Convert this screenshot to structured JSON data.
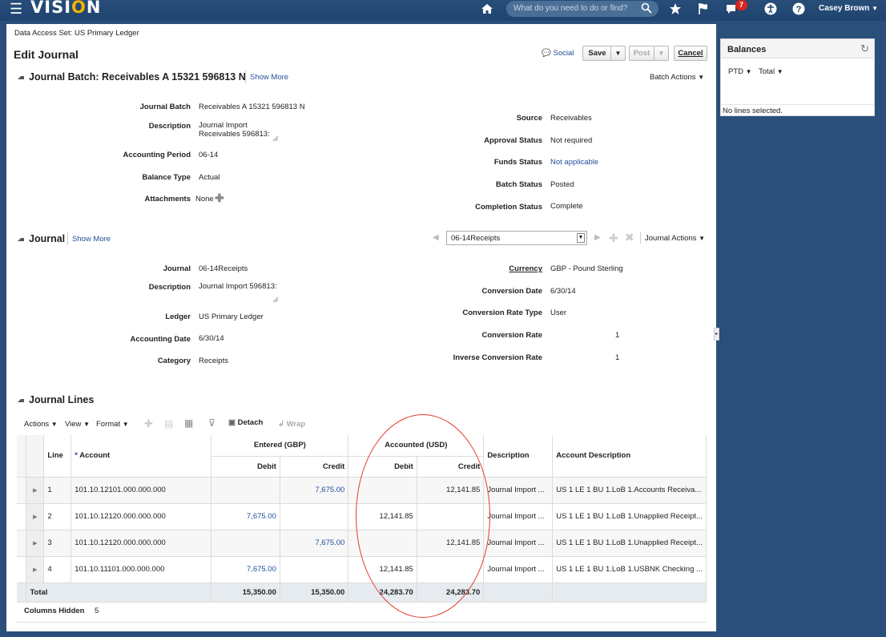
{
  "topbar": {
    "app_name_pre": "VISI",
    "app_name_o": "O",
    "app_name_post": "N",
    "search_placeholder": "What do you need to do or find?",
    "notification_count": "7",
    "user_name": "Casey Brown"
  },
  "page": {
    "data_access_set": "Data Access Set: US Primary Ledger",
    "title": "Edit Journal",
    "social": "Social",
    "save": "Save",
    "post": "Post",
    "cancel": "Cancel"
  },
  "batch": {
    "header": "Journal Batch: Receivables A 15321 596813 N",
    "show_more": "Show More",
    "batch_actions": "Batch Actions",
    "fields_left": [
      {
        "label": "Journal Batch",
        "value": "Receivables A 15321 596813 N"
      },
      {
        "label": "Description",
        "value": "Journal Import",
        "value2": "Receivables 596813:"
      },
      {
        "label": "Accounting Period",
        "value": "06-14"
      },
      {
        "label": "Balance Type",
        "value": "Actual"
      },
      {
        "label": "Attachments",
        "value": "None"
      }
    ],
    "fields_right": [
      {
        "label": "Source",
        "value": "Receivables"
      },
      {
        "label": "Approval Status",
        "value": "Not required"
      },
      {
        "label": "Funds Status",
        "value": "Not applicable"
      },
      {
        "label": "Batch Status",
        "value": "Posted"
      },
      {
        "label": "Completion Status",
        "value": "Complete"
      }
    ]
  },
  "journal": {
    "header": "Journal",
    "show_more": "Show More",
    "selector": "06-14Receipts",
    "journal_actions": "Journal Actions",
    "fields_left": [
      {
        "label": "Journal",
        "value": "06-14Receipts"
      },
      {
        "label": "Description",
        "value": "Journal Import 596813:"
      },
      {
        "label": "Ledger",
        "value": "US Primary Ledger"
      },
      {
        "label": "Accounting Date",
        "value": "6/30/14"
      },
      {
        "label": "Category",
        "value": "Receipts"
      }
    ],
    "fields_right": [
      {
        "label": "Currency",
        "value": "GBP - Pound Sterling"
      },
      {
        "label": "Conversion Date",
        "value": "6/30/14"
      },
      {
        "label": "Conversion Rate Type",
        "value": "User"
      },
      {
        "label": "Conversion Rate",
        "value": "1"
      },
      {
        "label": "Inverse Conversion Rate",
        "value": "1"
      }
    ]
  },
  "lines": {
    "header": "Journal Lines",
    "toolbar": {
      "actions": "Actions",
      "view": "View",
      "format": "Format",
      "detach": "Detach",
      "wrap": "Wrap"
    },
    "columns": {
      "line": "Line",
      "required_mark": "*",
      "account": "Account",
      "entered": "Entered (GBP)",
      "accounted": "Accounted (USD)",
      "debit": "Debit",
      "credit": "Credit",
      "description": "Description",
      "account_description": "Account Description"
    },
    "rows": [
      {
        "line": "1",
        "account": "101.10.12101.000.000.000",
        "ent_debit": "",
        "ent_credit": "7,675.00",
        "acc_debit": "",
        "acc_credit": "12,141.85",
        "description": "Journal Import ...",
        "account_description": "US 1 LE 1 BU 1.LoB 1.Accounts Receiva..."
      },
      {
        "line": "2",
        "account": "101.10.12120.000.000.000",
        "ent_debit": "7,675.00",
        "ent_credit": "",
        "acc_debit": "12,141.85",
        "acc_credit": "",
        "description": "Journal Import ...",
        "account_description": "US 1 LE 1 BU 1.LoB 1.Unapplied Receipt..."
      },
      {
        "line": "3",
        "account": "101.10.12120.000.000.000",
        "ent_debit": "",
        "ent_credit": "7,675.00",
        "acc_debit": "",
        "acc_credit": "12,141.85",
        "description": "Journal Import ...",
        "account_description": "US 1 LE 1 BU 1.LoB 1.Unapplied Receipt..."
      },
      {
        "line": "4",
        "account": "101.10.11101.000.000.000",
        "ent_debit": "7,675.00",
        "ent_credit": "",
        "acc_debit": "12,141.85",
        "acc_credit": "",
        "description": "Journal Import ...",
        "account_description": "US 1 LE 1 BU 1.LoB 1.USBNK Checking ..."
      }
    ],
    "total": {
      "label": "Total",
      "ent_debit": "15,350.00",
      "ent_credit": "15,350.00",
      "acc_debit": "24,283.70",
      "acc_credit": "24,283.70"
    },
    "columns_hidden_label": "Columns Hidden",
    "columns_hidden_count": "5"
  },
  "balances": {
    "title": "Balances",
    "ptd": "PTD",
    "total": "Total",
    "message": "No lines selected."
  }
}
